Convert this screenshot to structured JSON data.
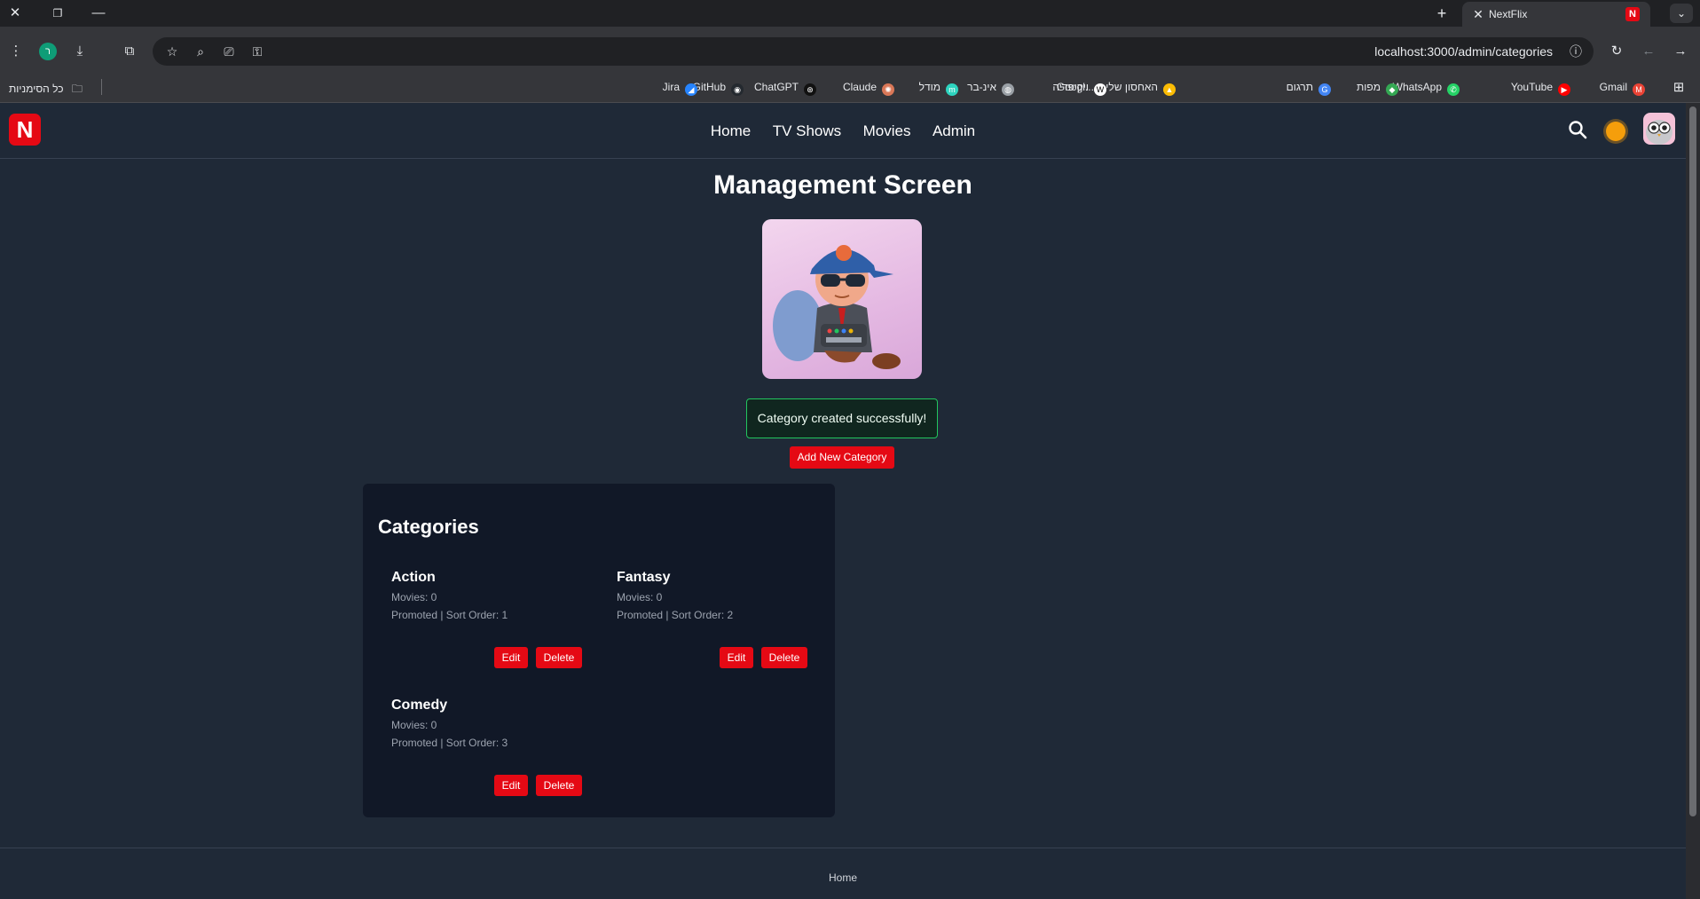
{
  "browser": {
    "tab_title": "NextFlix",
    "url": "localhost:3000/admin/categories",
    "profile_initial": "ר",
    "bookmarks": [
      {
        "label": "Gmail",
        "icon": "gmail-icon",
        "color": "#ea4335",
        "glyph": "M"
      },
      {
        "label": "YouTube",
        "icon": "youtube-icon",
        "color": "#ff0000",
        "glyph": "▶"
      },
      {
        "label": "WhatsApp",
        "icon": "whatsapp-icon",
        "color": "#25d366",
        "glyph": "✆"
      },
      {
        "label": "מפות",
        "icon": "maps-icon",
        "color": "#34a853",
        "glyph": "◆"
      },
      {
        "label": "תרגום",
        "icon": "translate-icon",
        "color": "#4285f4",
        "glyph": "G"
      },
      {
        "label": "Googl... – האחסון שלי",
        "icon": "drive-icon",
        "color": "#fbbc04",
        "glyph": "▲"
      },
      {
        "label": "ויקיפדיה",
        "icon": "wikipedia-icon",
        "color": "#ffffff",
        "glyph": "W"
      },
      {
        "label": "אינ-בר",
        "icon": "globe-icon",
        "color": "#9aa0a6",
        "glyph": "◍"
      },
      {
        "label": "מודל",
        "icon": "moodle-icon",
        "color": "#2dd4bf",
        "glyph": "m"
      },
      {
        "label": "Claude",
        "icon": "claude-icon",
        "color": "#d97757",
        "glyph": "✺"
      },
      {
        "label": "ChatGPT",
        "icon": "chatgpt-icon",
        "color": "#111111",
        "glyph": "⊛"
      },
      {
        "label": "GitHub",
        "icon": "github-icon",
        "color": "#24292f",
        "glyph": "◉"
      },
      {
        "label": "Jira",
        "icon": "jira-icon",
        "color": "#2684ff",
        "glyph": "◢"
      }
    ],
    "all_bookmarks": "כל הסימניות"
  },
  "nav": {
    "logo": "N",
    "links": [
      "Home",
      "TV Shows",
      "Movies",
      "Admin"
    ]
  },
  "page": {
    "title": "Management Screen",
    "alert": "Category created successfully!",
    "add_button": "Add New Category",
    "panel_title": "Categories",
    "categories": [
      {
        "name": "Action",
        "movies": "Movies: 0",
        "meta": "Promoted | Sort Order: 1"
      },
      {
        "name": "Fantasy",
        "movies": "Movies: 0",
        "meta": "Promoted | Sort Order: 2"
      },
      {
        "name": "Comedy",
        "movies": "Movies: 0",
        "meta": "Promoted | Sort Order: 3"
      }
    ],
    "edit_label": "Edit",
    "delete_label": "Delete",
    "footer_link": "Home"
  }
}
